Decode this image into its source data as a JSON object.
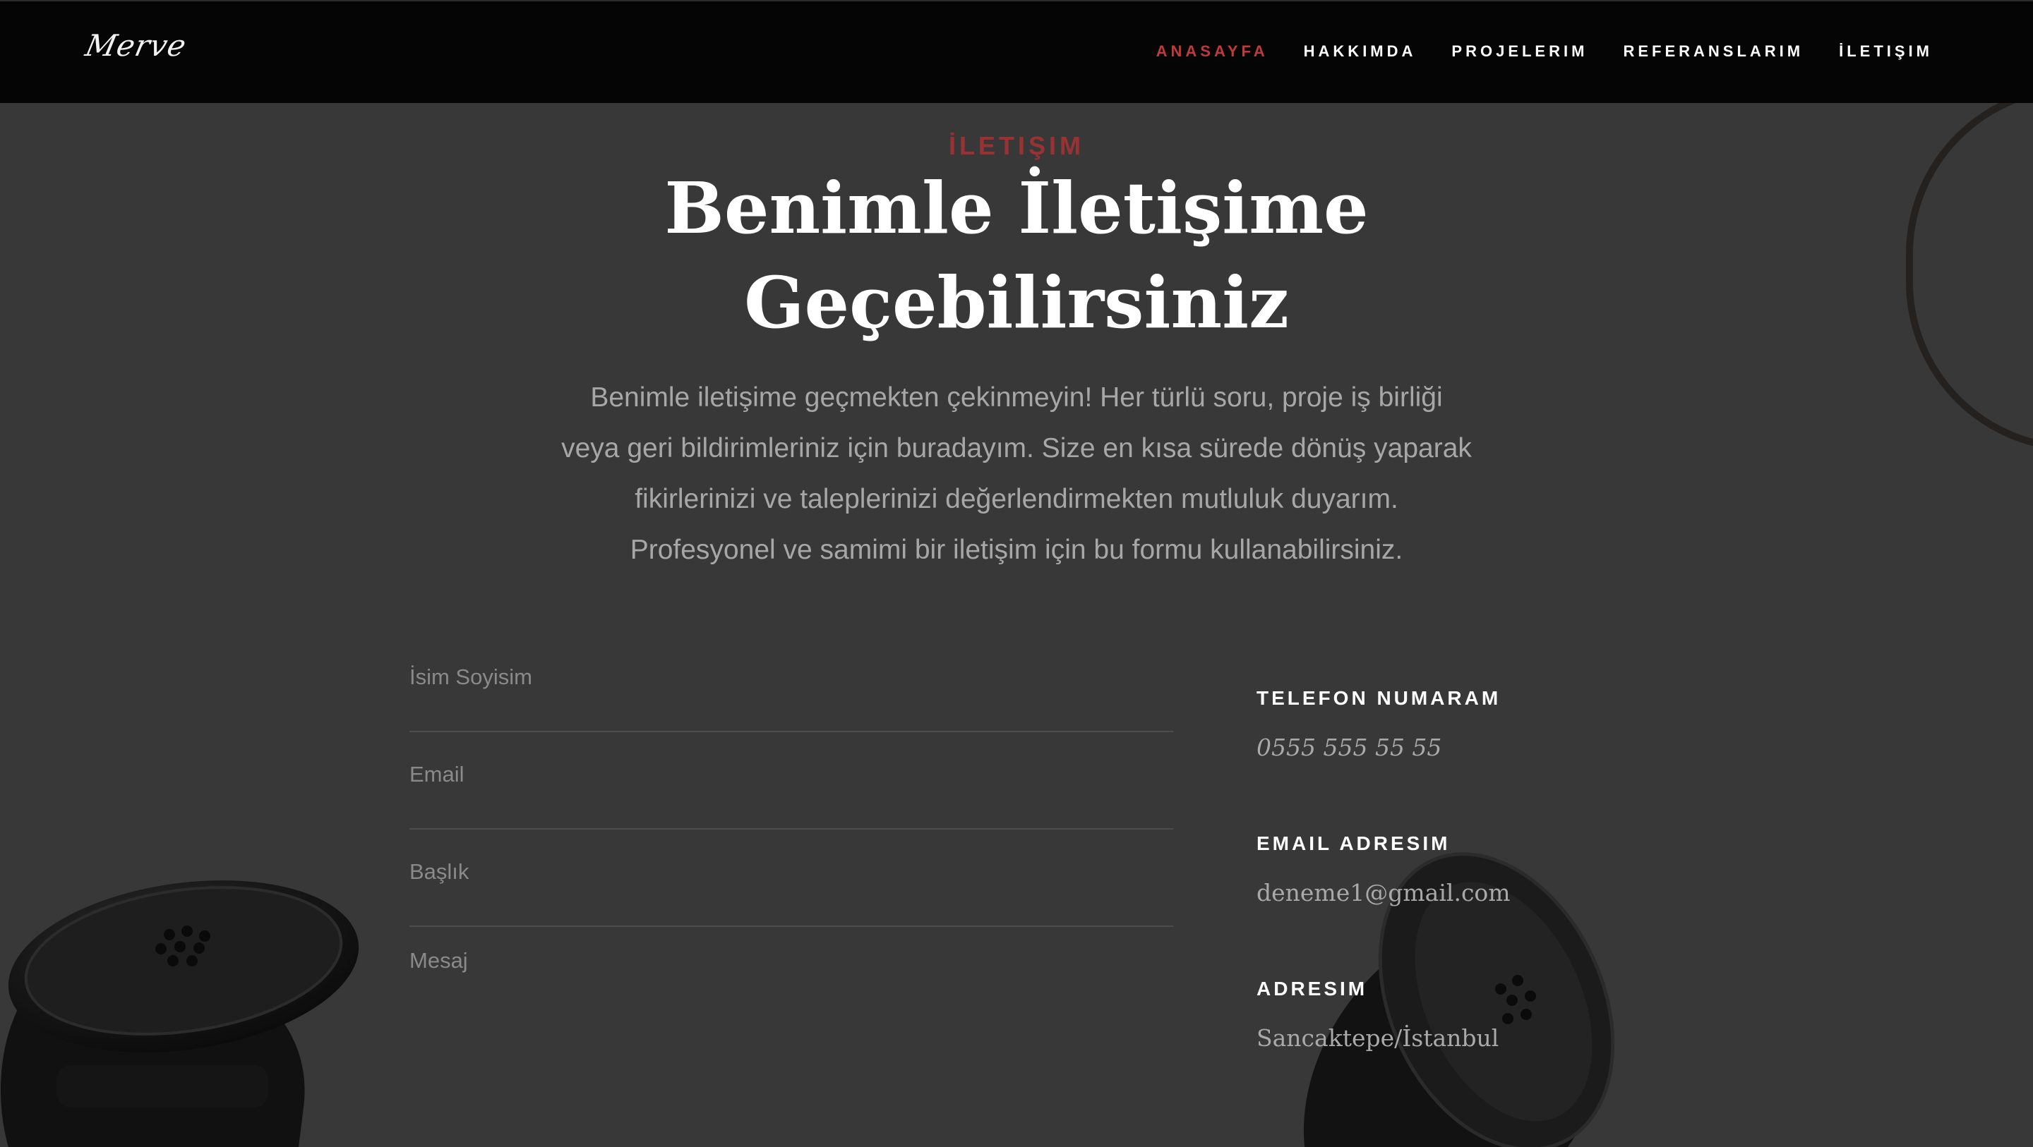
{
  "brand": {
    "logo_text": "Merve"
  },
  "nav": {
    "items": [
      {
        "label": "ANASAYFA",
        "active": true
      },
      {
        "label": "HAKKIMDA",
        "active": false
      },
      {
        "label": "PROJELERIM",
        "active": false
      },
      {
        "label": "REFERANSLARIM",
        "active": false
      },
      {
        "label": "İLETIŞIM",
        "active": false
      }
    ],
    "active_color": "#c0393b"
  },
  "section": {
    "eyebrow": "İLETIŞIM",
    "title_line1": "Benimle İletişime",
    "title_line2": "Geçebilirsiniz",
    "intro_line1": "Benimle iletişime geçmekten çekinmeyin! Her türlü soru, proje iş birliği",
    "intro_line2": "veya geri bildirimleriniz için buradayım. Size en kısa sürede dönüş yaparak",
    "intro_line3": "fikirlerinizi ve taleplerinizi değerlendirmekten mutluluk duyarım.",
    "intro_line4": "Profesyonel ve samimi bir iletişim için bu formu kullanabilirsiniz."
  },
  "form": {
    "name_placeholder": "İsim Soyisim",
    "email_placeholder": "Email",
    "subject_placeholder": "Başlık",
    "message_placeholder": "Mesaj"
  },
  "contact": {
    "phone_label": "TELEFON NUMARAM",
    "phone_value": "0555 555 55 55",
    "email_label": "EMAIL ADRESIM",
    "email_value": "deneme1@gmail.com",
    "address_label": "ADRESIM",
    "address_value": "Sancaktepe/İstanbul"
  },
  "icons": [
    "telephone-handset-left-image",
    "telephone-handset-right-image",
    "phone-cord-image"
  ],
  "colors": {
    "accent": "#c0393b",
    "background": "#383838",
    "header": "#050505"
  }
}
